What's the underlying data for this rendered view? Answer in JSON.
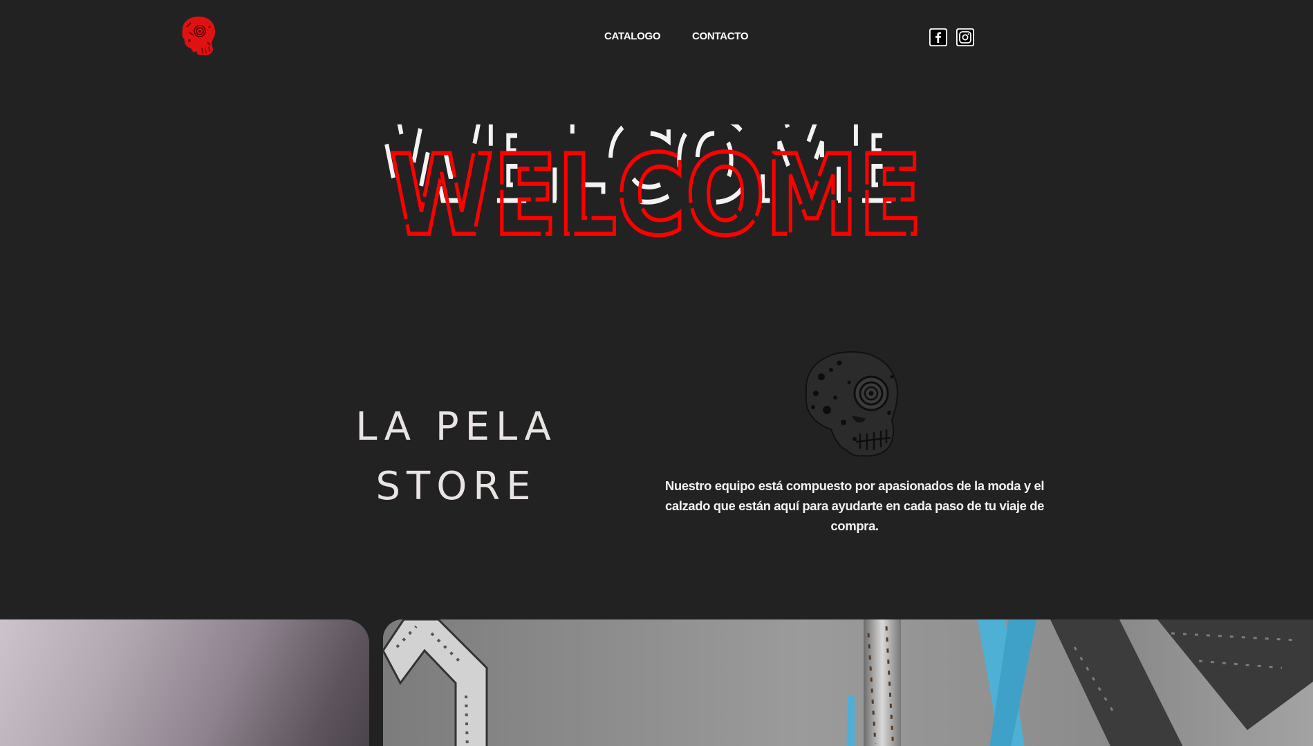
{
  "header": {
    "logo_icon": "red-skull-logo-icon",
    "nav": [
      {
        "label": "CATALOGO"
      },
      {
        "label": "CONTACTO"
      }
    ],
    "social": [
      {
        "icon": "facebook-icon"
      },
      {
        "icon": "instagram-icon"
      }
    ]
  },
  "hero": {
    "headline": "WELCOME",
    "colors": {
      "stroke": "#ff0000",
      "glitch": "#ffffff"
    }
  },
  "about": {
    "title_line1": "LA PELA",
    "title_line2": "STORE",
    "skull_icon": "skull-target-eye-icon",
    "description": "Nuestro equipo está compuesto por apasionados de la moda y el calzado que están aquí para ayudarte en cada paso de tu viaje de compra."
  },
  "gallery": {
    "items": [
      {
        "name": "gradient-photo-card"
      },
      {
        "name": "sneaker-laces-photo-card"
      }
    ]
  },
  "theme": {
    "background": "#222222",
    "accent": "#ff0000",
    "text": "#ffffff"
  }
}
